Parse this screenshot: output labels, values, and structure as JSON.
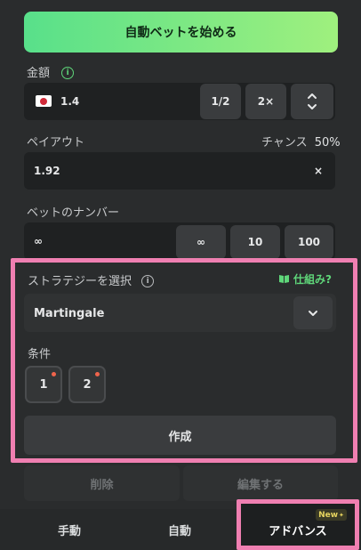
{
  "start_button": "自動ベットを始める",
  "amount": {
    "label": "金額",
    "value": "1.4",
    "half": "1/2",
    "double": "2×"
  },
  "payout": {
    "label": "ペイアウト",
    "chance_label": "チャンス",
    "chance_value": "50%",
    "value": "1.92",
    "clear": "×"
  },
  "bet_number": {
    "label": "ベットのナンバー",
    "value": "∞",
    "options": [
      "∞",
      "10",
      "100"
    ]
  },
  "strategy": {
    "label": "ストラテジーを選択",
    "how_link": "仕組み?",
    "selected": "Martingale",
    "conditions_label": "条件",
    "conditions": [
      "1",
      "2"
    ],
    "create": "作成"
  },
  "actions": {
    "delete": "削除",
    "edit": "編集する"
  },
  "tabs": {
    "manual": "手動",
    "auto": "自動",
    "advanced": "アドバンス",
    "new_badge": "New"
  },
  "colors": {
    "accent_green": "#5fd77a",
    "highlight_pink": "#ef7fb1",
    "badge_yellow": "#d9c85a"
  }
}
